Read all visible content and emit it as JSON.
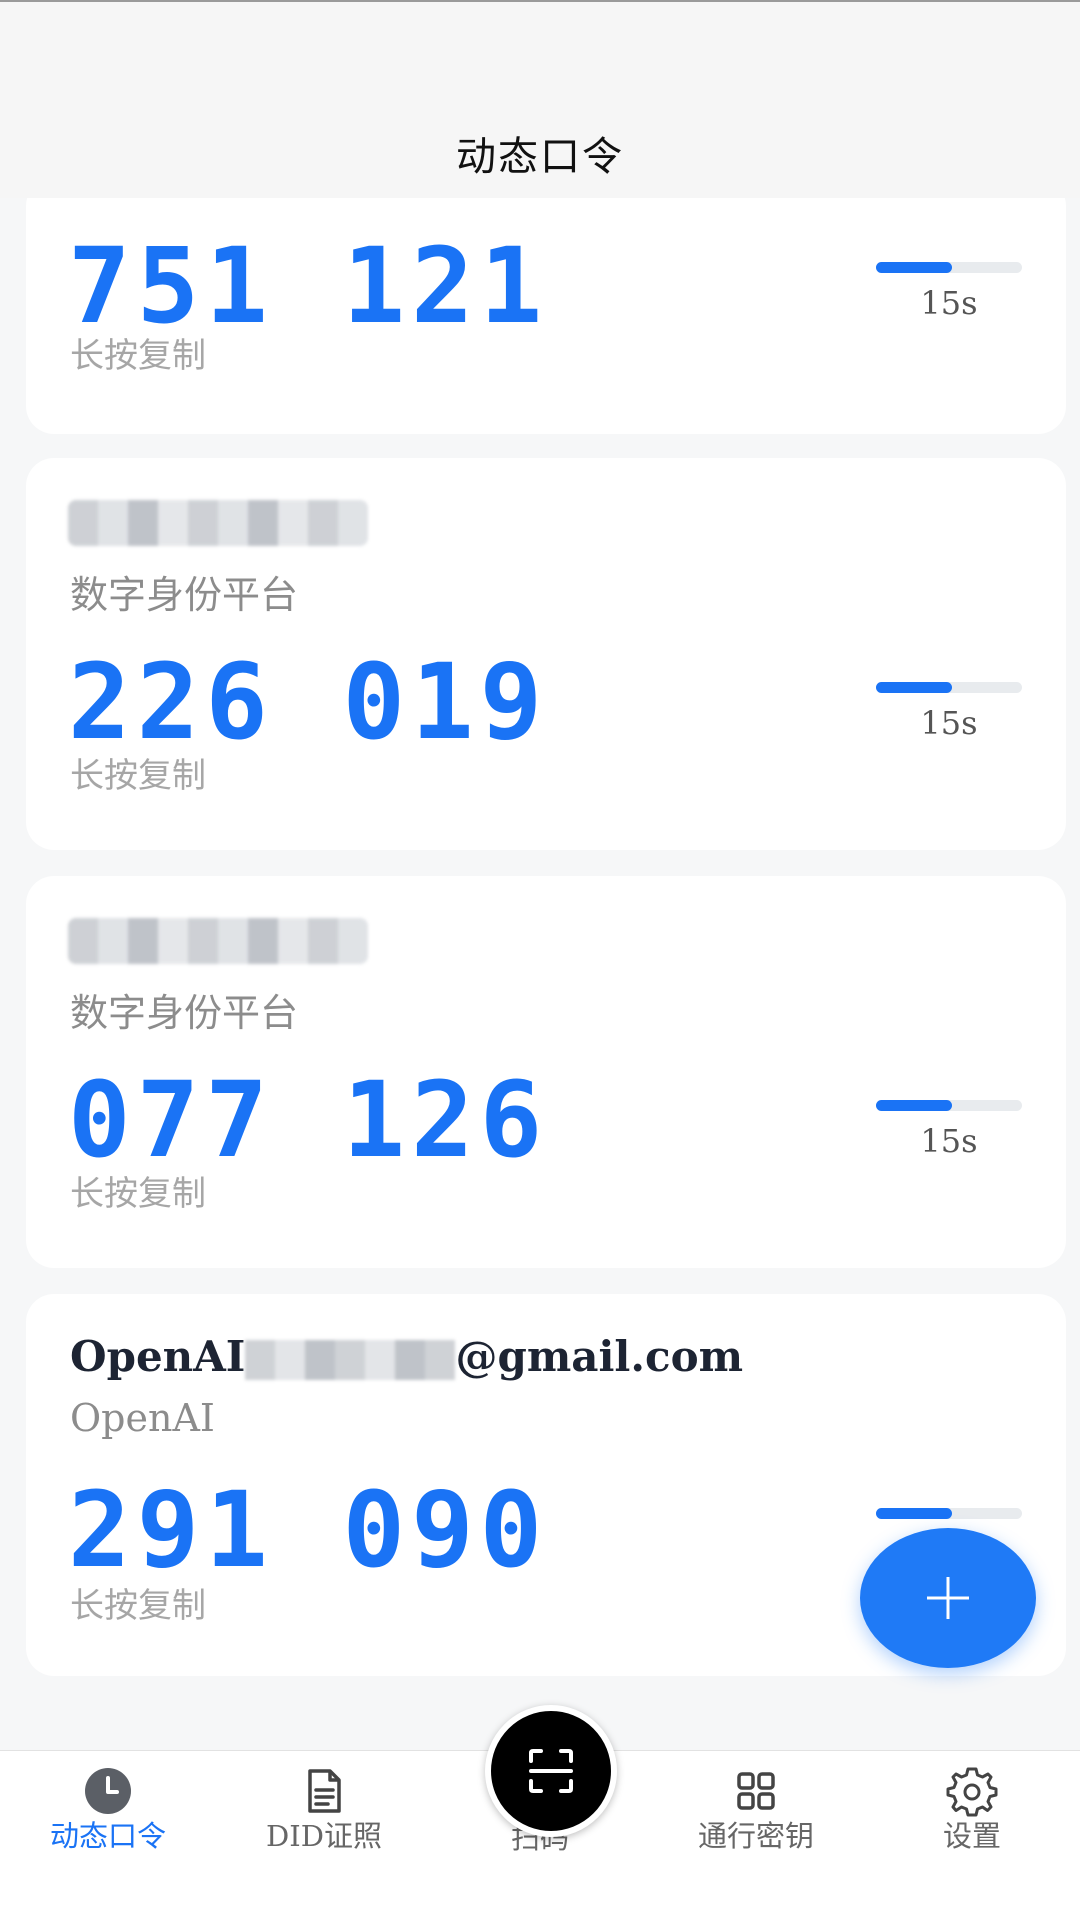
{
  "header": {
    "title": "动态口令"
  },
  "cards": [
    {
      "code": "751 121",
      "copy_hint": "长按复制",
      "timer_label": "15s",
      "progress": 0.52
    },
    {
      "issuer": "数字身份平台",
      "code": "226 019",
      "copy_hint": "长按复制",
      "timer_label": "15s",
      "progress": 0.52
    },
    {
      "issuer": "数字身份平台",
      "code": "077 126",
      "copy_hint": "长按复制",
      "timer_label": "15s",
      "progress": 0.52
    },
    {
      "account_prefix": "OpenAI",
      "account_suffix": "@gmail.com",
      "issuer": "OpenAI",
      "code": "291 090",
      "copy_hint": "长按复制",
      "progress": 0.52
    }
  ],
  "fab": {
    "icon": "plus-icon"
  },
  "bottom_nav": {
    "items": [
      {
        "label": "动态口令",
        "icon": "clock-icon",
        "active": true
      },
      {
        "label": "DID证照",
        "icon": "document-icon",
        "active": false
      },
      {
        "label": "扫码",
        "icon": "scan-icon",
        "active": false
      },
      {
        "label": "通行密钥",
        "icon": "grid-icon",
        "active": false
      },
      {
        "label": "设置",
        "icon": "gear-icon",
        "active": false
      }
    ]
  },
  "colors": {
    "accent": "#1a73f5",
    "background": "#f6f7f8",
    "card": "#ffffff"
  }
}
